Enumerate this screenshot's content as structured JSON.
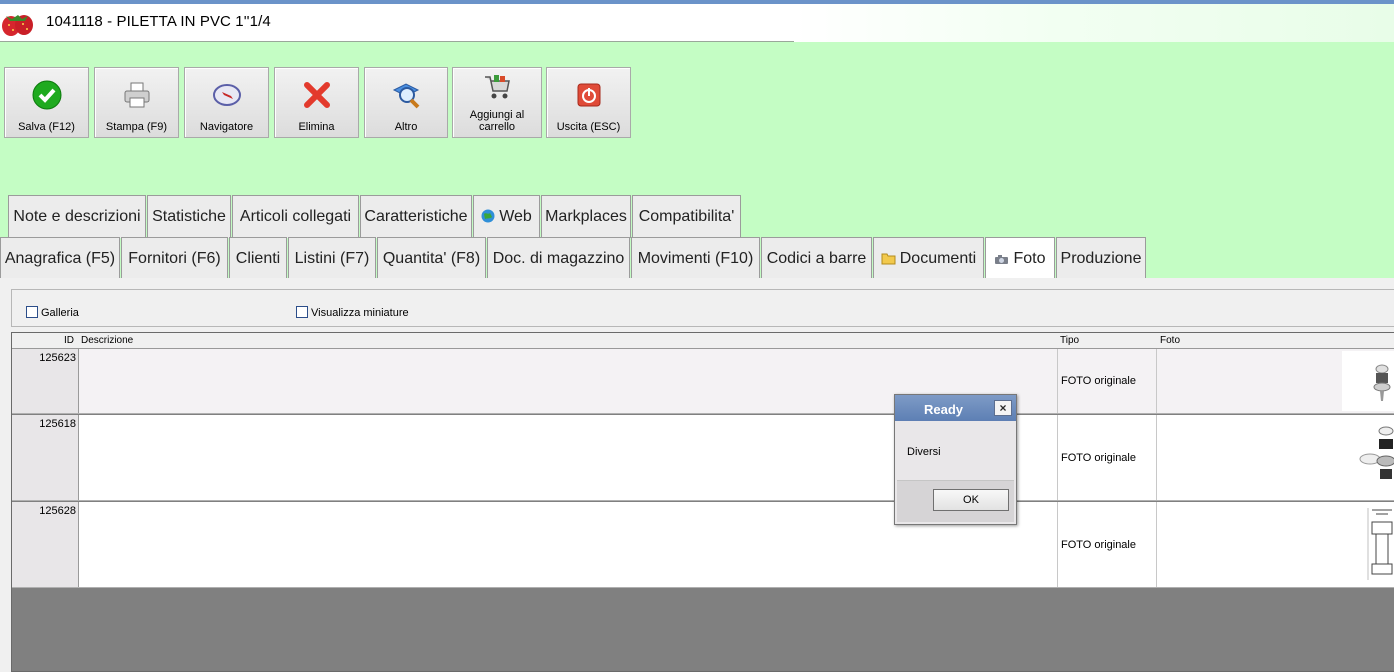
{
  "window": {
    "title": "1041118 - PILETTA IN PVC  1''1/4"
  },
  "toolbar": {
    "buttons": [
      {
        "label": "Salva (F12)",
        "icon": "check-icon"
      },
      {
        "label": "Stampa (F9)",
        "icon": "printer-icon"
      },
      {
        "label": "Navigatore",
        "icon": "compass-icon"
      },
      {
        "label": "Elimina",
        "icon": "delete-x-icon"
      },
      {
        "label": "Altro",
        "icon": "search-magnifier-icon"
      },
      {
        "label": "Aggiungi al carrello",
        "icon": "cart-icon"
      },
      {
        "label": "Uscita (ESC)",
        "icon": "power-icon"
      }
    ]
  },
  "tabs_row1": [
    "Note e descrizioni",
    "Statistiche",
    "Articoli collegati",
    "Caratteristiche",
    "Web",
    "Markplaces",
    "Compatibilita'"
  ],
  "tabs_row2": [
    "Anagrafica (F5)",
    "Fornitori (F6)",
    "Clienti",
    "Listini (F7)",
    "Quantita' (F8)",
    "Doc. di magazzino",
    "Movimenti (F10)",
    "Codici a barre",
    "Documenti",
    "Foto",
    "Produzione"
  ],
  "active_tab": "Foto",
  "options": {
    "galleria": "Galleria",
    "miniature": "Visualizza miniature"
  },
  "grid": {
    "headers": {
      "id": "ID",
      "descrizione": "Descrizione",
      "tipo": "Tipo",
      "foto": "Foto"
    },
    "rows": [
      {
        "id": "125623",
        "descrizione": "",
        "tipo": "FOTO originale"
      },
      {
        "id": "125618",
        "descrizione": "",
        "tipo": "FOTO originale"
      },
      {
        "id": "125628",
        "descrizione": "",
        "tipo": "FOTO originale"
      }
    ]
  },
  "dialog": {
    "title": "Ready",
    "message": "Diversi",
    "ok_label": "OK"
  }
}
